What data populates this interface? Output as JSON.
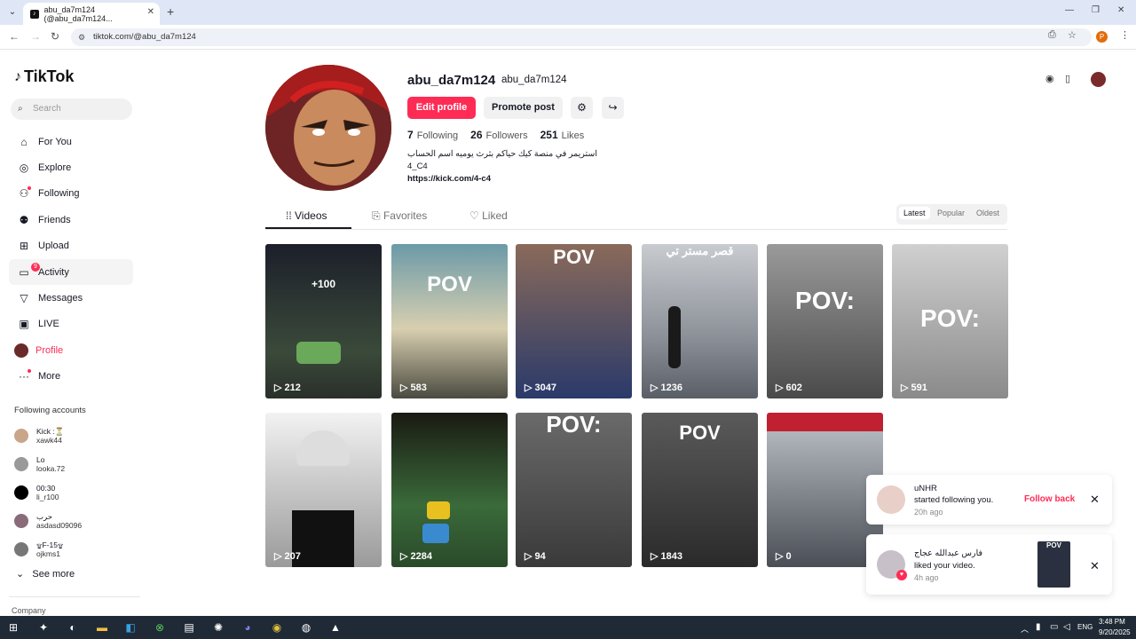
{
  "browser": {
    "tab_title": "abu_da7m124 (@abu_da7m124...",
    "url": "tiktok.com/@abu_da7m124"
  },
  "sidebar": {
    "logo": "TikTok",
    "search_placeholder": "Search",
    "nav": [
      {
        "label": "For You",
        "icon": "home-icon"
      },
      {
        "label": "Explore",
        "icon": "compass-icon"
      },
      {
        "label": "Following",
        "icon": "user-follow-icon"
      },
      {
        "label": "Friends",
        "icon": "friends-icon"
      },
      {
        "label": "Upload",
        "icon": "upload-icon"
      },
      {
        "label": "Activity",
        "icon": "activity-icon",
        "badge": "9"
      },
      {
        "label": "Messages",
        "icon": "send-icon"
      },
      {
        "label": "LIVE",
        "icon": "live-icon"
      },
      {
        "label": "Profile",
        "icon": "avatar"
      },
      {
        "label": "More",
        "icon": "more-icon"
      }
    ],
    "following_title": "Following accounts",
    "following": [
      {
        "name": "Kick :⏳",
        "handle": "xawk44"
      },
      {
        "name": "Lo",
        "handle": "looka.72"
      },
      {
        "name": "00:30",
        "handle": "li_r100"
      },
      {
        "name": "حرب",
        "handle": "asdasd09096"
      },
      {
        "name": "۩F-15۩",
        "handle": "ojkms1"
      }
    ],
    "see_more": "See more",
    "company": "Company"
  },
  "profile": {
    "username": "abu_da7m124",
    "nickname": "abu_da7m124",
    "edit_label": "Edit profile",
    "promote_label": "Promote post",
    "following_count": "7",
    "following_label": "Following",
    "followers_count": "26",
    "followers_label": "Followers",
    "likes_count": "251",
    "likes_label": "Likes",
    "bio_line1": "استريمر في منصة كيك حياكم بثرث يوميه اسم الحساب",
    "bio_line2": "4_C4",
    "bio_link": "https://kick.com/4-c4"
  },
  "tabs": {
    "videos": "Videos",
    "favorites": "Favorites",
    "liked": "Liked"
  },
  "sort": {
    "latest": "Latest",
    "popular": "Popular",
    "oldest": "Oldest"
  },
  "videos": [
    {
      "views": "212",
      "overlay": "+100"
    },
    {
      "views": "583",
      "overlay": "POV"
    },
    {
      "views": "3047",
      "overlay": "POV"
    },
    {
      "views": "1236",
      "overlay": "قصر مستر تي"
    },
    {
      "views": "602",
      "overlay": "POV:"
    },
    {
      "views": "591",
      "overlay": "POV:"
    },
    {
      "views": "207",
      "overlay": ""
    },
    {
      "views": "2284",
      "overlay": ""
    },
    {
      "views": "94",
      "overlay": "POV:"
    },
    {
      "views": "1843",
      "overlay": "POV"
    },
    {
      "views": "0",
      "overlay": ""
    }
  ],
  "notifications": [
    {
      "user": "uNHR",
      "action": "started following you.",
      "time": "20h ago",
      "button": "Follow back"
    },
    {
      "user": "فارس عبدالله عجاج",
      "action": "liked your video.",
      "time": "4h ago",
      "thumb": "POV"
    }
  ],
  "taskbar": {
    "lang": "ENG",
    "time": "3:48 PM",
    "date": "9/20/2025"
  }
}
